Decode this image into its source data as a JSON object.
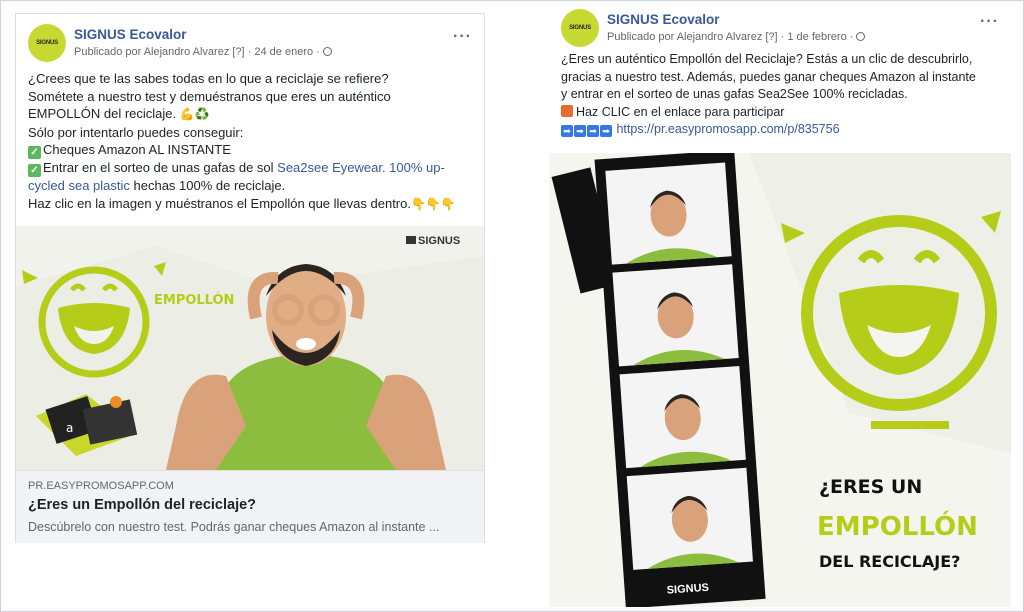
{
  "left_post": {
    "page_name": "SIGNUS Ecovalor",
    "avatar_text": "SIGNUS",
    "meta": "Publicado por Alejandro Alvarez [?] · 24 de enero ·",
    "lines": {
      "l1": "¿Crees que te las sabes todas en lo que a reciclaje se refiere?",
      "l2": "Sométete a nuestro test y demuéstranos que eres un auténtico",
      "l3": "EMPOLLÓN del reciclaje.",
      "l3_emoji": "💪♻️",
      "l4": "Sólo por intentarlo puedes conseguir:",
      "l5": "Cheques Amazon AL INSTANTE",
      "l6_pre": "Entrar en el sorteo de unas gafas de sol ",
      "l6_link": "Sea2see Eyewear. 100% up-",
      "l7_link": "cycled sea plastic",
      "l7_post": " hechas 100% de reciclaje.",
      "l8": "Haz clic en la imagen y muéstranos el Empollón que llevas dentro.",
      "l8_emoji": "👇👇👇"
    },
    "image": {
      "brand": "SIGNUS",
      "word": "EMPOLLÓN",
      "card_letter": "a"
    },
    "link_preview": {
      "domain": "PR.EASYPROMOSAPP.COM",
      "title": "¿Eres un Empollón del reciclaje?",
      "description": "Descúbrelo con nuestro test. Podrás ganar cheques Amazon al instante ..."
    }
  },
  "right_post": {
    "page_name": "SIGNUS Ecovalor",
    "avatar_text": "SIGNUS",
    "meta": "Publicado por Alejandro Alvarez [?] · 1 de febrero ·",
    "lines": {
      "l1": "¿Eres un auténtico Empollón del Reciclaje? Estás a un clic de descubrirlo,",
      "l2": "gracias a nuestro test. Además, puedes ganar cheques Amazon al instante",
      "l3": "y entrar en el sorteo de unas gafas Sea2See 100% recicladas.",
      "l4": "Haz CLIC en el enlace para participar",
      "l5_link": "https://pr.easypromosapp.com/p/835756"
    },
    "image": {
      "brand": "SIGNUS",
      "tag1": "¿ERES UN",
      "tag2": "EMPOLLÓN",
      "tag3": "DEL RECICLAJE?"
    }
  },
  "colors": {
    "accent_green": "#b5cc18",
    "link_blue": "#385898",
    "shirt_green": "#8cbd3f"
  }
}
